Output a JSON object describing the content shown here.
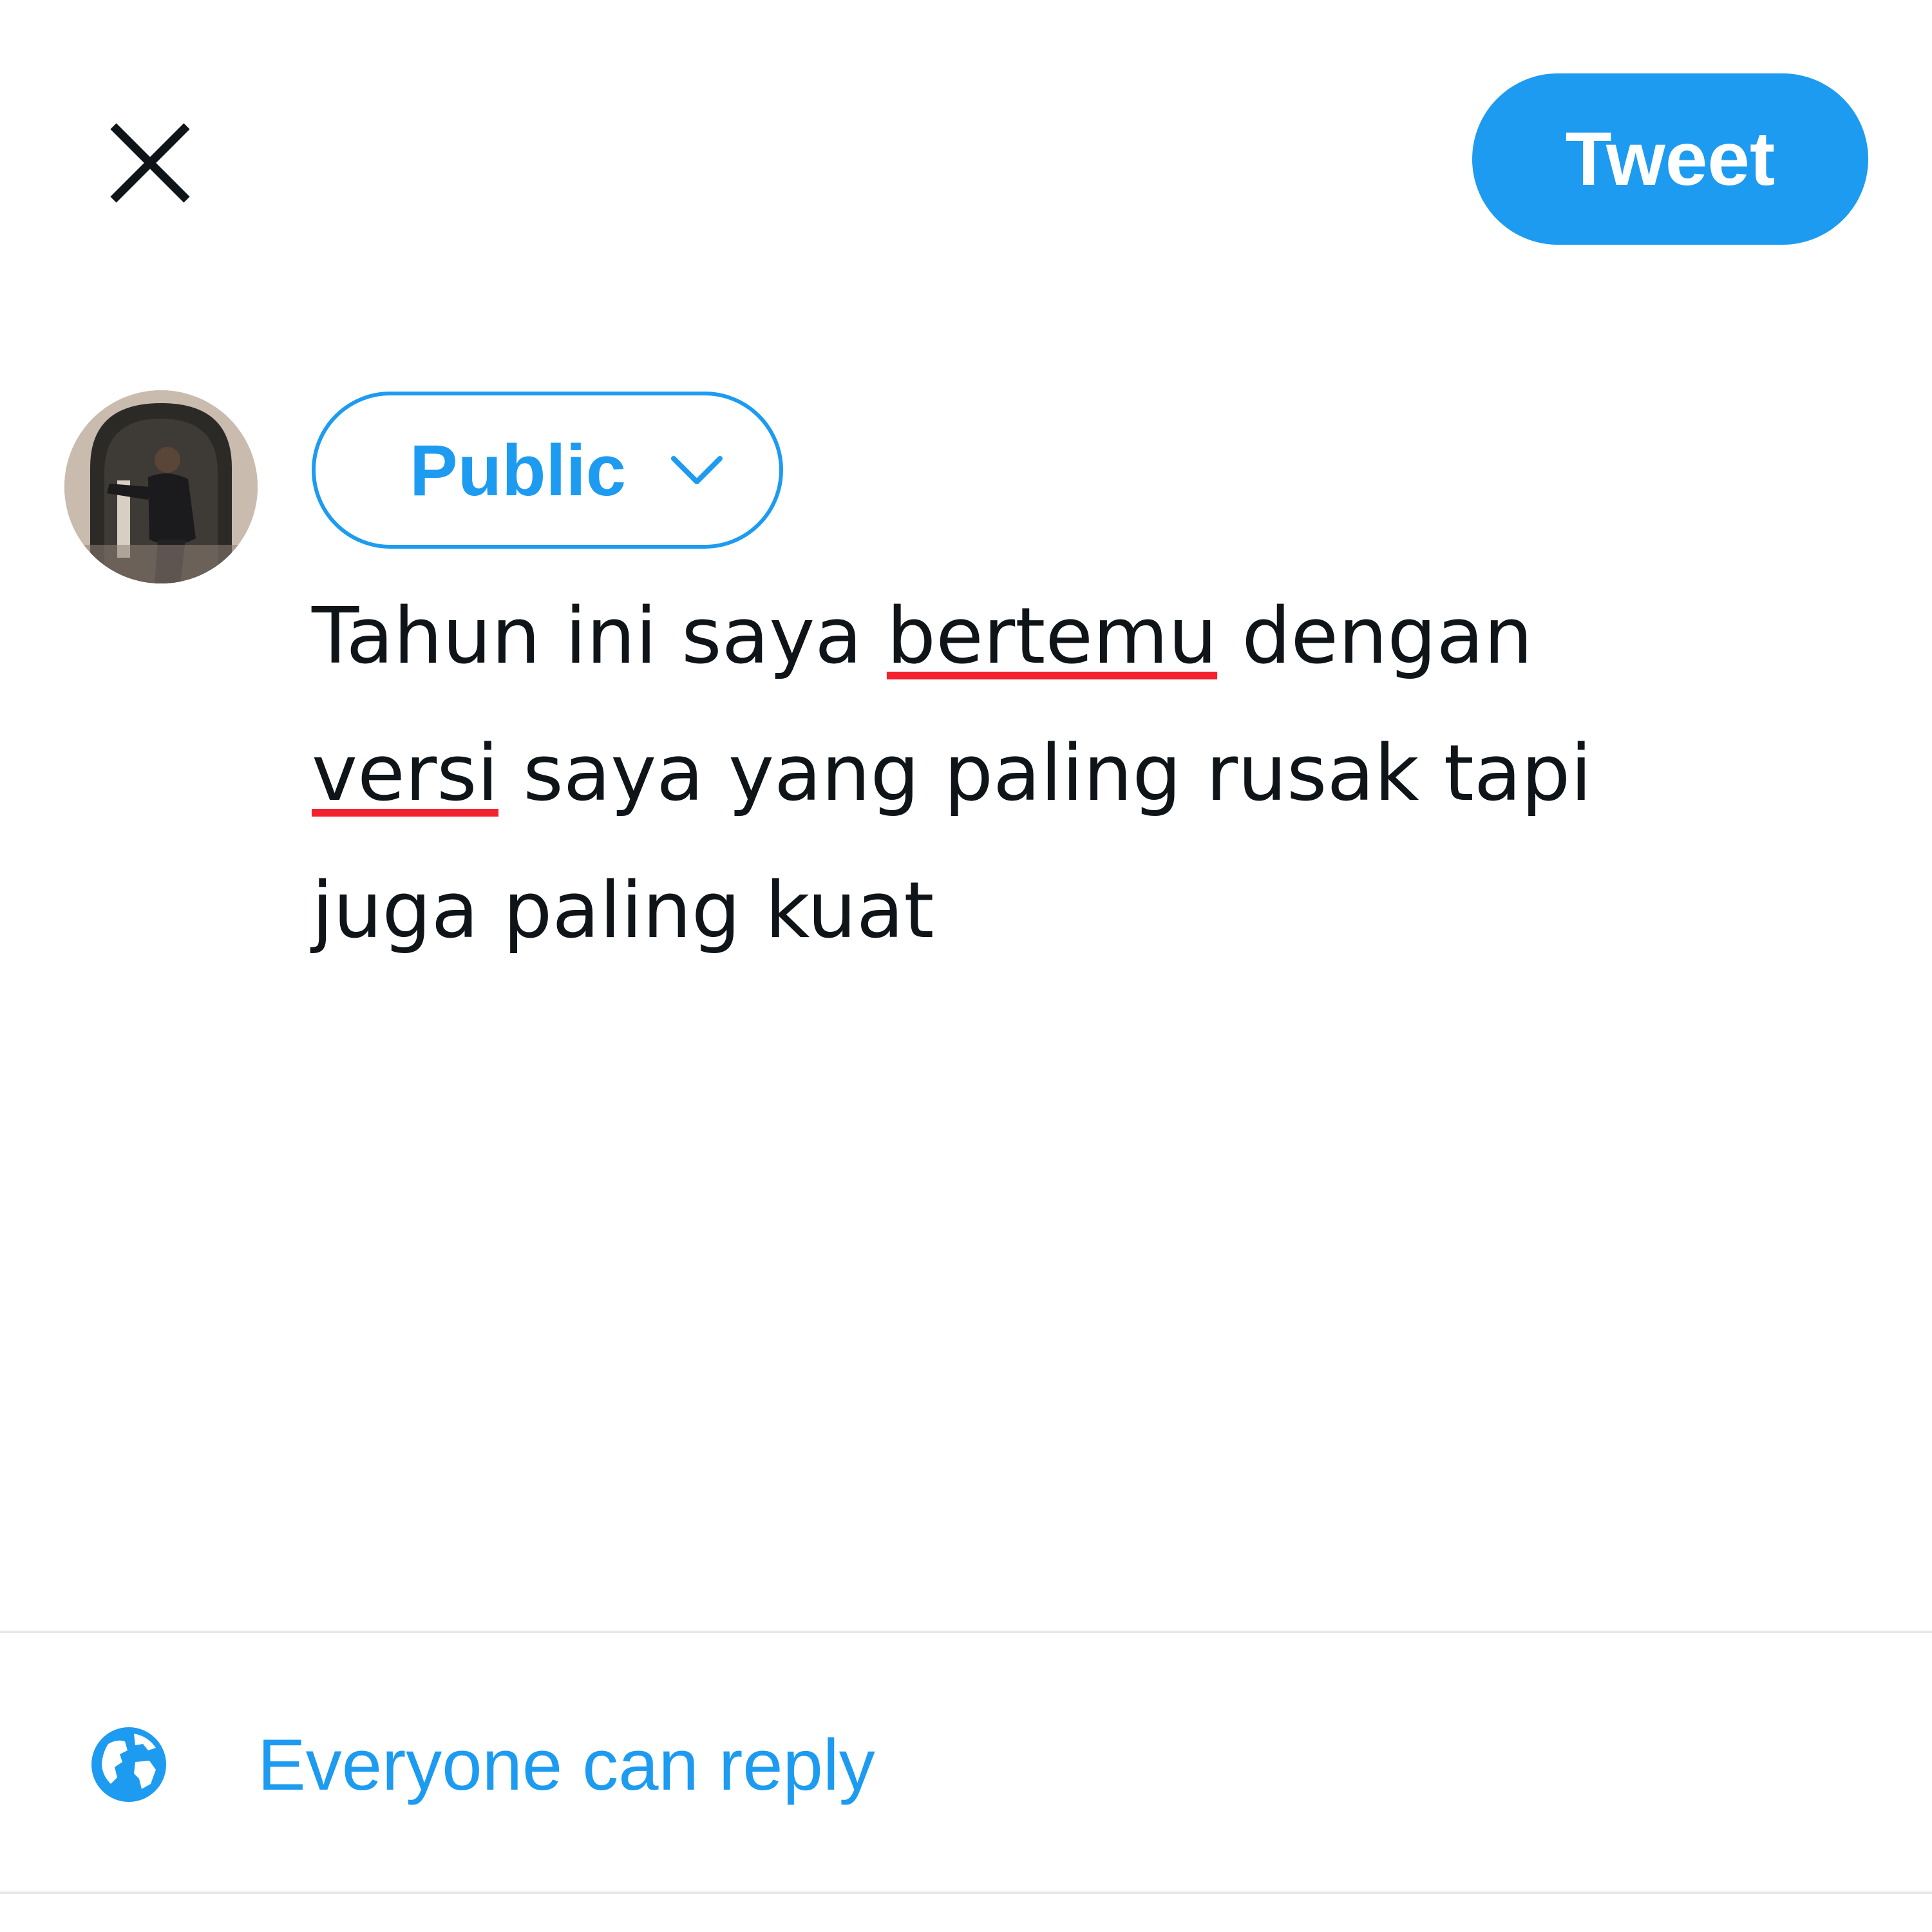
{
  "header": {
    "close_icon": "close-icon",
    "tweet_button_label": "Tweet"
  },
  "composer": {
    "audience_label": "Public",
    "audience_chevron_icon": "chevron-down-icon",
    "text_lines": [
      [
        "Tahun ini saya ",
        "bertemu",
        " dengan"
      ],
      [
        "versi",
        " saya yang paling rusak tapi"
      ],
      [
        "juga paling kuat"
      ]
    ],
    "misspelled_words": [
      "bertemu",
      "versi"
    ]
  },
  "reply_setting": {
    "icon": "globe-icon",
    "label": "Everyone can reply"
  },
  "colors": {
    "accent": "#1d9bf0",
    "text": "#0f1419",
    "spellcheck_underline": "#f4212e",
    "divider": "#e6e9ea"
  }
}
